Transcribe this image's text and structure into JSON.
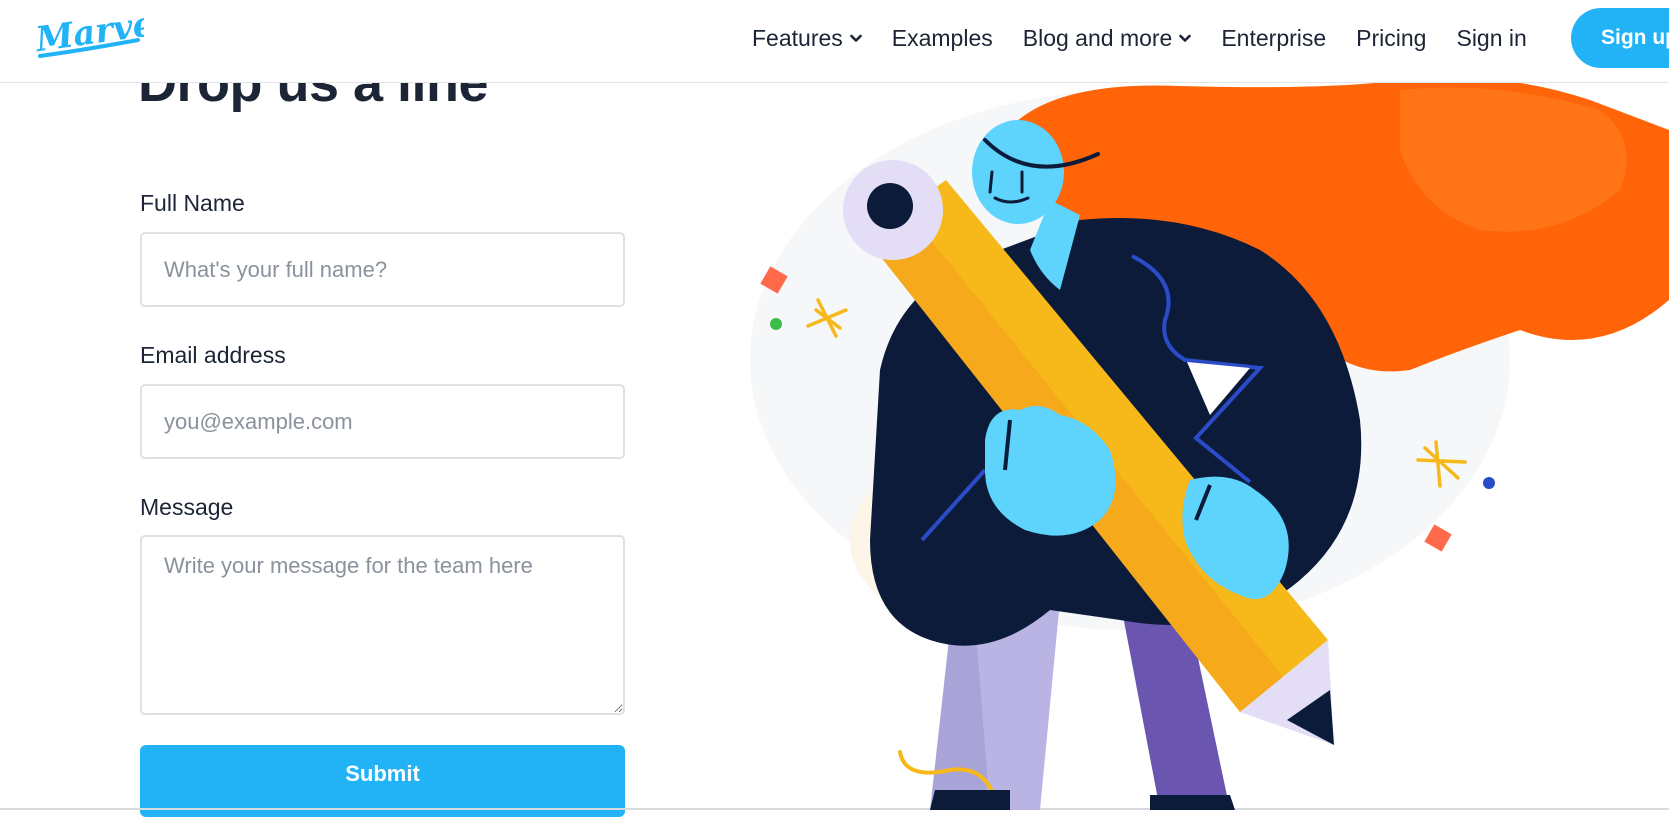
{
  "brand": {
    "logo_text": "Marvel"
  },
  "nav": {
    "items": [
      {
        "label": "Features",
        "has_dropdown": true
      },
      {
        "label": "Examples",
        "has_dropdown": false
      },
      {
        "label": "Blog and more",
        "has_dropdown": true
      },
      {
        "label": "Enterprise",
        "has_dropdown": false
      },
      {
        "label": "Pricing",
        "has_dropdown": false
      },
      {
        "label": "Sign in",
        "has_dropdown": false
      }
    ],
    "signup_label": "Sign up"
  },
  "form": {
    "title": "Drop us a line",
    "full_name": {
      "label": "Full Name",
      "placeholder": "What's your full name?",
      "value": ""
    },
    "email": {
      "label": "Email address",
      "placeholder": "you@example.com",
      "value": ""
    },
    "message": {
      "label": "Message",
      "placeholder": "Write your message for the team here",
      "value": ""
    },
    "submit_label": "Submit"
  },
  "colors": {
    "accent": "#22b3f7",
    "text": "#1c2535",
    "hair": "#ff6408",
    "pencil": "#f7b81a",
    "jacket": "#0c1b3a",
    "skin": "#5ed3fb",
    "pants": "#a9a4d8"
  },
  "icons": [
    "chevron-down-icon",
    "marvel-logo"
  ]
}
